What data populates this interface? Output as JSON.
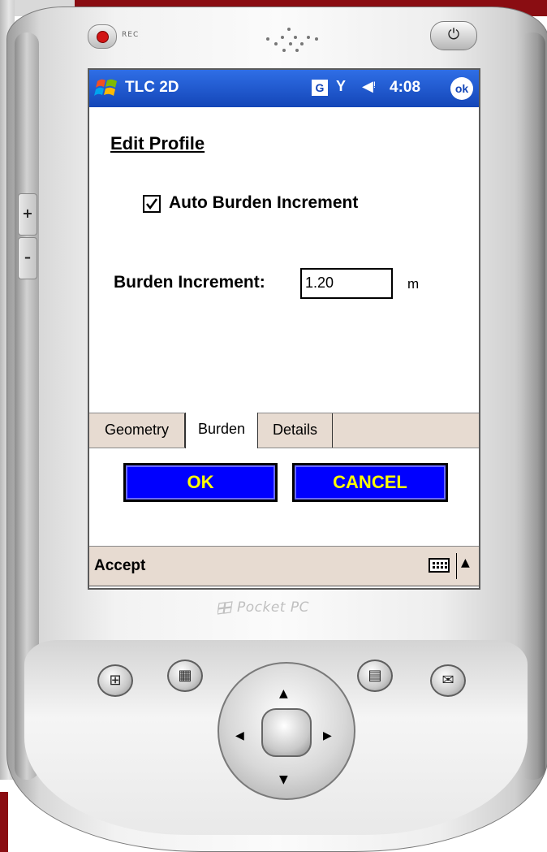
{
  "device": {
    "rec_label": "REC",
    "power_glyph": "⏻",
    "volume_plus": "+",
    "volume_minus": "–",
    "brand": "Pocket PC"
  },
  "titlebar": {
    "app_title": "TLC 2D",
    "g_badge": "G",
    "signal_glyph": "Y",
    "volume_glyph": "◀ᵎ",
    "time": "4:08",
    "ok_label": "ok"
  },
  "form": {
    "page_title": "Edit Profile",
    "auto_burden": {
      "label": "Auto Burden Increment",
      "checked": true
    },
    "burden_increment": {
      "label": "Burden Increment:",
      "value": "1.20",
      "unit": "m"
    }
  },
  "tabs": [
    {
      "label": "Geometry",
      "active": false
    },
    {
      "label": "Burden",
      "active": true
    },
    {
      "label": "Details",
      "active": false
    }
  ],
  "buttons": {
    "ok": "OK",
    "cancel": "CANCEL"
  },
  "menubar": {
    "left_softkey": "Accept",
    "sip_arrow": "▲"
  },
  "hardware_buttons": {
    "start_glyph": "⊞",
    "calendar_glyph": "▦",
    "contacts_glyph": "▤",
    "mail_glyph": "✉"
  },
  "colors": {
    "titlebar": "#1446b8",
    "button_bg": "#0000ff",
    "button_text": "#ffff00",
    "tab_bg": "#e7dbd1",
    "frame_accent": "#8a0d12"
  }
}
